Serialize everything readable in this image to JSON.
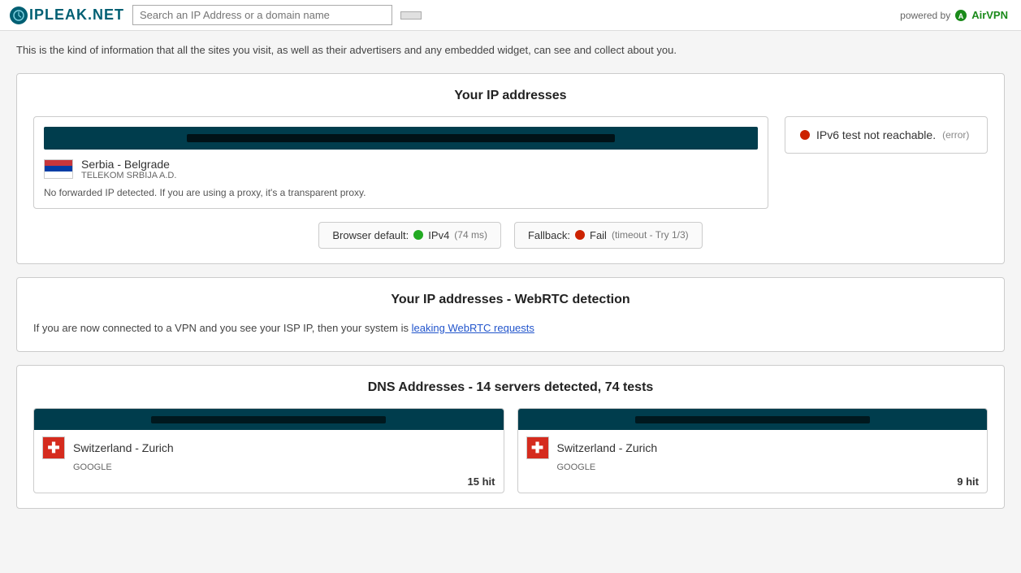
{
  "header": {
    "logo_text": "IPLEAK.NET",
    "search_placeholder": "Search an IP Address or a domain name",
    "search_btn_label": "",
    "powered_by_label": "powered by",
    "airvpn_label": "AirVPN"
  },
  "intro": {
    "text": "This is the kind of information that all the sites you visit, as well as their advertisers and any embedded widget, can see and collect about you."
  },
  "ip_section": {
    "title": "Your IP addresses",
    "ip_bar_redacted": true,
    "location_city": "Serbia - Belgrade",
    "location_isp": "TELEKOM SRBIJA a.d.",
    "no_forward": "No forwarded IP detected. If you are using a proxy, it's a transparent proxy.",
    "ipv6_label": "IPv6 test not reachable.",
    "ipv6_error": "(error)",
    "browser_default_label": "Browser default:",
    "browser_protocol": "IPv4",
    "browser_ms": "(74 ms)",
    "fallback_label": "Fallback:",
    "fallback_status": "Fail",
    "fallback_detail": "(timeout - Try 1/3)"
  },
  "webrtc_section": {
    "title": "Your IP addresses - WebRTC detection",
    "text": "If you are now connected to a VPN and you see your ISP IP, then your system is",
    "link_text": "leaking WebRTC requests"
  },
  "dns_section": {
    "title": "DNS Addresses - 14 servers detected, 74 tests",
    "entries": [
      {
        "location": "Switzerland - Zurich",
        "isp": "GOOGLE",
        "hits": "15 hit"
      },
      {
        "location": "Switzerland - Zurich",
        "isp": "GOOGLE",
        "hits": "9 hit"
      }
    ]
  },
  "colors": {
    "header_bg": "#ffffff",
    "card_bg": "#ffffff",
    "ip_bar_bg": "#003d4d",
    "dot_red": "#cc2200",
    "dot_green": "#22aa22",
    "link_color": "#2255cc"
  }
}
